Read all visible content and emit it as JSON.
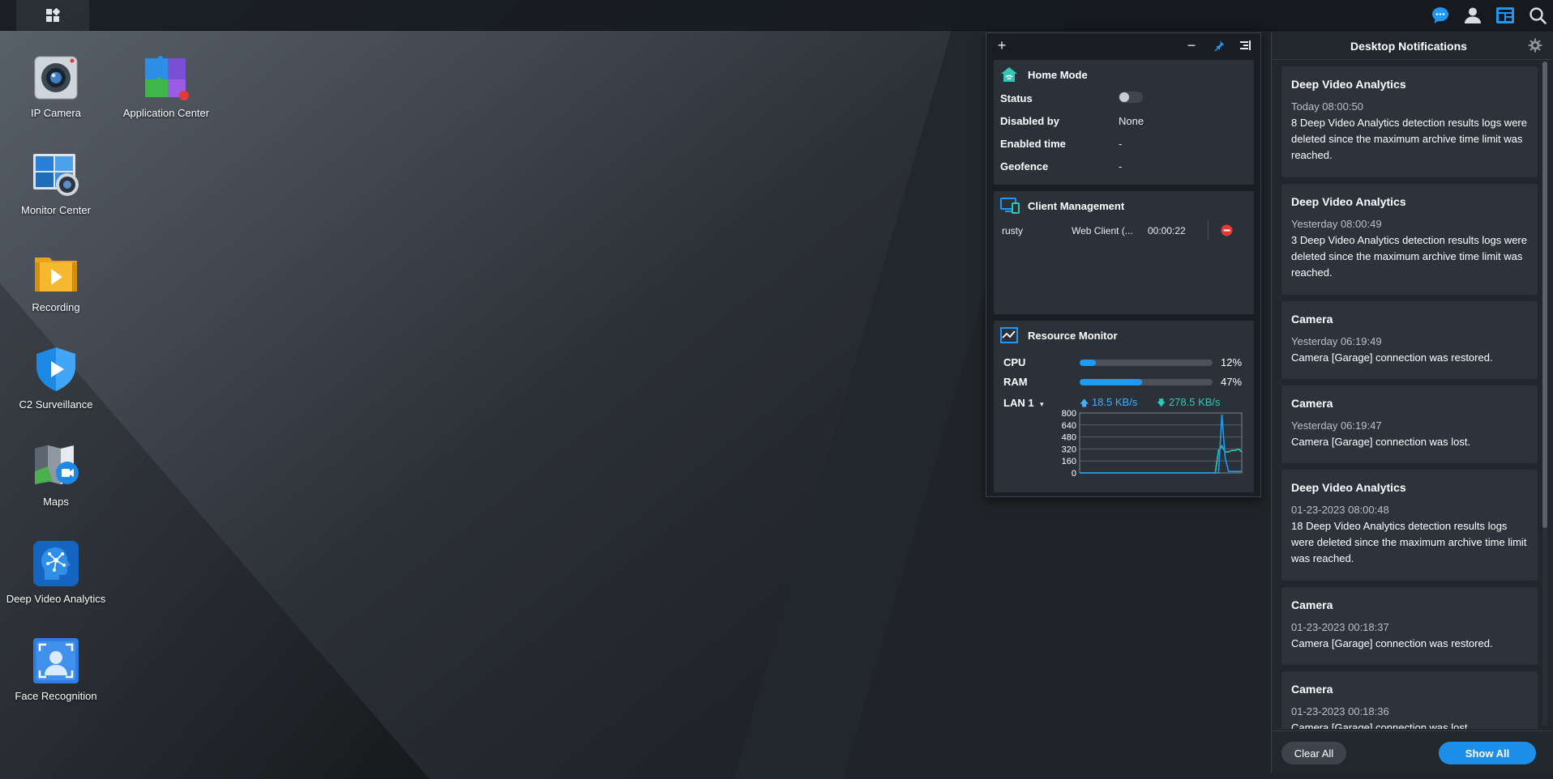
{
  "colors": {
    "accent": "#1e9bf0",
    "upload": "#3fb0ff",
    "download": "#31c6b8",
    "danger": "#e53935"
  },
  "taskbar": {
    "main_menu_icon": "grid-icon",
    "icons": [
      "chat-bubble-icon",
      "user-icon",
      "widgets-icon",
      "search-icon"
    ]
  },
  "desktop": {
    "icons": [
      {
        "label": "IP Camera",
        "icon": "ip-camera-icon"
      },
      {
        "label": "Application Center",
        "icon": "puzzle-icon"
      },
      {
        "label": "Monitor Center",
        "icon": "monitor-center-icon"
      },
      {
        "label": "Recording",
        "icon": "recording-folder-icon"
      },
      {
        "label": "C2 Surveillance",
        "icon": "c2-shield-icon"
      },
      {
        "label": "Maps",
        "icon": "maps-icon"
      },
      {
        "label": "Deep Video Analytics",
        "icon": "deep-video-analytics-icon"
      },
      {
        "label": "Face Recognition",
        "icon": "face-recognition-icon"
      }
    ]
  },
  "widgets": {
    "toolbar": {
      "add": "+",
      "minimize": "−"
    },
    "home_mode": {
      "title": "Home Mode",
      "rows": [
        {
          "key": "Status",
          "value": "",
          "toggle_on": false
        },
        {
          "key": "Disabled by",
          "value": "None"
        },
        {
          "key": "Enabled time",
          "value": "-"
        },
        {
          "key": "Geofence",
          "value": "-"
        }
      ]
    },
    "client_management": {
      "title": "Client Management",
      "clients": [
        {
          "user": "rusty",
          "client": "Web Client (...",
          "duration": "00:00:22"
        }
      ]
    },
    "resource_monitor": {
      "title": "Resource Monitor",
      "cpu": {
        "label": "CPU",
        "percent": 12,
        "percent_text": "12%"
      },
      "ram": {
        "label": "RAM",
        "percent": 47,
        "percent_text": "47%"
      },
      "lan": {
        "label": "LAN 1",
        "upload": "18.5 KB/s",
        "download": "278.5 KB/s"
      },
      "chart": {
        "y_ticks": [
          "800",
          "640",
          "480",
          "320",
          "160",
          "0"
        ],
        "ylim": [
          0,
          800
        ],
        "upload_series": [
          0,
          0,
          0,
          0,
          0,
          0,
          0,
          0,
          0,
          0,
          0,
          0,
          0,
          0,
          0,
          0,
          0,
          0,
          0,
          0,
          0,
          0,
          0,
          0,
          0,
          0,
          0,
          0,
          0,
          0,
          0,
          0,
          0,
          0,
          0,
          0,
          0,
          0,
          0,
          0,
          0,
          0,
          0,
          780,
          200,
          20,
          20,
          20,
          20,
          20
        ],
        "download_series": [
          0,
          0,
          0,
          0,
          0,
          0,
          0,
          0,
          0,
          0,
          0,
          0,
          0,
          0,
          0,
          0,
          0,
          0,
          0,
          0,
          0,
          0,
          0,
          0,
          0,
          0,
          0,
          0,
          0,
          0,
          0,
          0,
          0,
          0,
          0,
          0,
          0,
          0,
          0,
          0,
          0,
          0,
          300,
          360,
          280,
          280,
          300,
          300,
          320,
          280
        ]
      }
    }
  },
  "notifications": {
    "title": "Desktop Notifications",
    "items": [
      {
        "title": "Deep Video Analytics",
        "time": "Today 08:00:50",
        "message": "8 Deep Video Analytics detection results logs were deleted since the maximum archive time limit was reached."
      },
      {
        "title": "Deep Video Analytics",
        "time": "Yesterday 08:00:49",
        "message": "3 Deep Video Analytics detection results logs were deleted since the maximum archive time limit was reached."
      },
      {
        "title": "Camera",
        "time": "Yesterday 06:19:49",
        "message": "Camera [Garage] connection was restored."
      },
      {
        "title": "Camera",
        "time": "Yesterday 06:19:47",
        "message": "Camera [Garage] connection was lost."
      },
      {
        "title": "Deep Video Analytics",
        "time": "01-23-2023 08:00:48",
        "message": "18 Deep Video Analytics detection results logs were deleted since the maximum archive time limit was reached."
      },
      {
        "title": "Camera",
        "time": "01-23-2023 00:18:37",
        "message": "Camera [Garage] connection was restored."
      },
      {
        "title": "Camera",
        "time": "01-23-2023 00:18:36",
        "message": "Camera [Garage] connection was lost."
      }
    ],
    "clear_label": "Clear All",
    "show_all_label": "Show All"
  }
}
